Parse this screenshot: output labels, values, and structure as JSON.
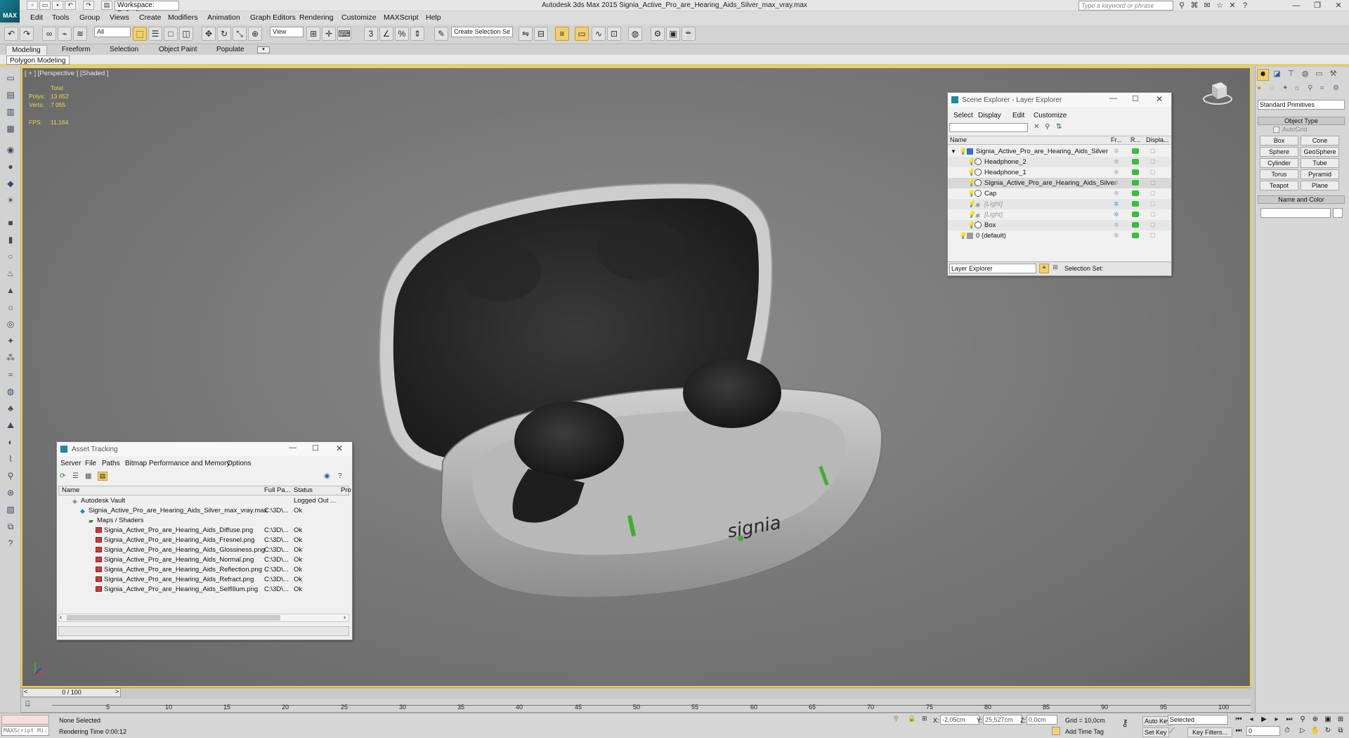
{
  "app": {
    "title": "Autodesk 3ds Max  2015    Signia_Active_Pro_are_Hearing_Aids_Silver_max_vray.max",
    "logo": "MAX",
    "workspace": "Workspace: Default",
    "help_search_placeholder": "Type a keyword or phrase"
  },
  "menu": [
    "Edit",
    "Tools",
    "Group",
    "Views",
    "Create",
    "Modifiers",
    "Animation",
    "Graph Editors",
    "Rendering",
    "Customize",
    "MAXScript",
    "Help"
  ],
  "toolbar": {
    "selection_filter": "All",
    "ref_coord": "View",
    "named_selection_placeholder": "Create Selection Se"
  },
  "ribbon": {
    "tabs": [
      "Modeling",
      "Freeform",
      "Selection",
      "Object Paint",
      "Populate"
    ],
    "active_sub": "Polygon Modeling"
  },
  "viewport": {
    "label": "[ + ] [Perspective ] [Shaded ]",
    "stats": {
      "total_label": "Total",
      "polys_label": "Polys:",
      "polys": "13 652",
      "verts_label": "Verts:",
      "verts": "7 055",
      "fps_label": "FPS:",
      "fps": "11,164"
    },
    "model_text": "signia",
    "axis_x": "x",
    "axis_y": "y",
    "axis_z": "z"
  },
  "scene_explorer": {
    "title": "Scene Explorer - Layer Explorer",
    "menu": [
      "Select",
      "Display",
      "Edit",
      "Customize"
    ],
    "columns": [
      "Name",
      "Fr...",
      "R...",
      "Displa..."
    ],
    "rows": [
      {
        "name": "Signia_Active_Pro_are_Hearing_Aids_Silver"
      },
      {
        "name": "Headphone_2"
      },
      {
        "name": "Headphone_1"
      },
      {
        "name": "Signia_Active_Pro_are_Hearing_Aids_Silver"
      },
      {
        "name": "Cap"
      },
      {
        "name": "[Light]"
      },
      {
        "name": "[Light]"
      },
      {
        "name": "Box"
      },
      {
        "name": "0 (default)"
      }
    ],
    "footer_select": "Layer Explorer",
    "selection_set_label": "Selection Set:"
  },
  "command_panel": {
    "category": "Standard Primitives",
    "object_type_title": "Object Type",
    "autogrid": "AutoGrid",
    "buttons": [
      "Box",
      "Cone",
      "Sphere",
      "GeoSphere",
      "Cylinder",
      "Tube",
      "Torus",
      "Pyramid",
      "Teapot",
      "Plane"
    ],
    "name_color_title": "Name and Color"
  },
  "asset_tracking": {
    "title": "Asset Tracking",
    "menu": [
      "Server",
      "File",
      "Paths",
      "Bitmap Performance and Memory",
      "Options"
    ],
    "columns": [
      "Name",
      "Full Pa...",
      "Status",
      "Pro"
    ],
    "rows": [
      {
        "name": "Autodesk Vault",
        "path": "",
        "status": "Logged Out ..."
      },
      {
        "name": "Signia_Active_Pro_are_Hearing_Aids_Silver_max_vray.max",
        "path": "C:\\3D\\...",
        "status": "Ok"
      },
      {
        "name": "Maps / Shaders",
        "path": "",
        "status": ""
      },
      {
        "name": "Signia_Active_Pro_are_Hearing_Aids_Diffuse.png",
        "path": "C:\\3D\\...",
        "status": "Ok"
      },
      {
        "name": "Signia_Active_Pro_are_Hearing_Aids_Fresnel.png",
        "path": "C:\\3D\\...",
        "status": "Ok"
      },
      {
        "name": "Signia_Active_Pro_are_Hearing_Aids_Glossiness.png",
        "path": "C:\\3D\\...",
        "status": "Ok"
      },
      {
        "name": "Signia_Active_Pro_are_Hearing_Aids_Normal.png",
        "path": "C:\\3D\\...",
        "status": "Ok"
      },
      {
        "name": "Signia_Active_Pro_are_Hearing_Aids_Reflection.png",
        "path": "C:\\3D\\...",
        "status": "Ok"
      },
      {
        "name": "Signia_Active_Pro_are_Hearing_Aids_Refract.png",
        "path": "C:\\3D\\...",
        "status": "Ok"
      },
      {
        "name": "Signia_Active_Pro_are_Hearing_Aids_SelfIllum.png",
        "path": "C:\\3D\\...",
        "status": "Ok"
      }
    ]
  },
  "timeline": {
    "frame": "0 / 100",
    "ticks": [
      "5",
      "10",
      "15",
      "20",
      "25",
      "30",
      "35",
      "40",
      "45",
      "50",
      "55",
      "60",
      "65",
      "70",
      "75",
      "80",
      "85",
      "90",
      "95",
      "100"
    ]
  },
  "status": {
    "maxscript": "MAXScript Mi:",
    "selection": "None Selected",
    "render_time": "Rendering Time  0:00:12",
    "x_label": "X:",
    "x": "-2,05cm",
    "y_label": "Y:",
    "y": "25,527cm",
    "z_label": "Z:",
    "z": "0,0cm",
    "grid": "Grid = 10,0cm",
    "add_time_tag": "Add Time Tag",
    "auto_key": "Auto Key",
    "set_key": "Set Key",
    "key_mode": "Selected",
    "key_filters": "Key Filters...",
    "current_frame": "0"
  },
  "colors": {
    "viewport_border": "#f0d23a",
    "stats_text": "#f2d44a",
    "render_green": "#3bbd3b"
  }
}
